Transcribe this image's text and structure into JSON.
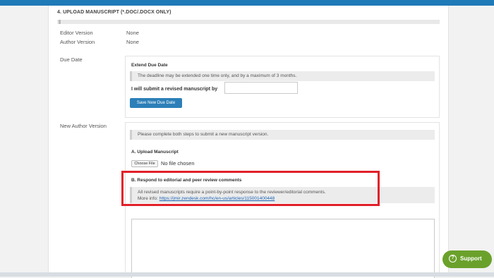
{
  "section": {
    "title": "4. UPLOAD MANUSCRIPT (*.DOC/.DOCX ONLY)"
  },
  "editor_version": {
    "label": "Editor Version",
    "value": "None"
  },
  "author_version": {
    "label": "Author Version",
    "value": "None"
  },
  "due_date": {
    "label": "Due Date",
    "heading": "Extend Due Date",
    "notice": "The deadline may be extended one time only, and by a maximum of 3 months.",
    "submit_label": "I will submit a revised manuscript by",
    "input_value": "",
    "button_label": "Save New Due Date"
  },
  "new_author_version": {
    "label": "New Author Version",
    "notice": "Please complete both steps to submit a new manuscript version.",
    "step_a_heading": "A. Upload Manuscript",
    "choose_file_label": "Choose File",
    "file_status": "No file chosen",
    "step_b_heading": "B. Respond to editorial and peer review comments",
    "step_b_notice": "All revised manuscripts require a point-by-point response to the reviewer/editorial comments.",
    "more_info_prefix": "More info: ",
    "more_info_link": "https://jmir.zendesk.com/hc/en-us/articles/115001400448",
    "response_text": ""
  },
  "support": {
    "label": "Support",
    "icon": "question-circle-icon",
    "color": "#6aa12b"
  },
  "colors": {
    "topbar": "#1f7ab8",
    "button": "#2c7fb8",
    "highlight": "#e2202a"
  }
}
